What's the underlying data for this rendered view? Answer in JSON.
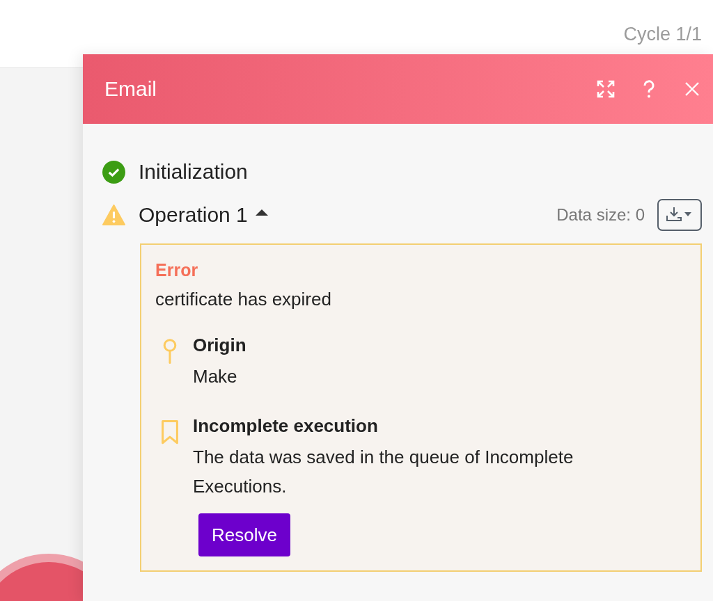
{
  "cycle": "Cycle 1/1",
  "panel": {
    "title": "Email",
    "operations": [
      {
        "kind": "success",
        "label": "Initialization"
      },
      {
        "kind": "warning",
        "label": "Operation 1",
        "expanded": true,
        "data_size": "Data size: 0"
      }
    ],
    "error": {
      "heading": "Error",
      "message": "certificate has expired",
      "details": [
        {
          "kind": "origin",
          "title": "Origin",
          "text": "Make"
        },
        {
          "kind": "bookmark",
          "title": "Incomplete execution",
          "text": "The data was saved in the queue of Incomplete Executions."
        }
      ],
      "button": "Resolve"
    }
  }
}
